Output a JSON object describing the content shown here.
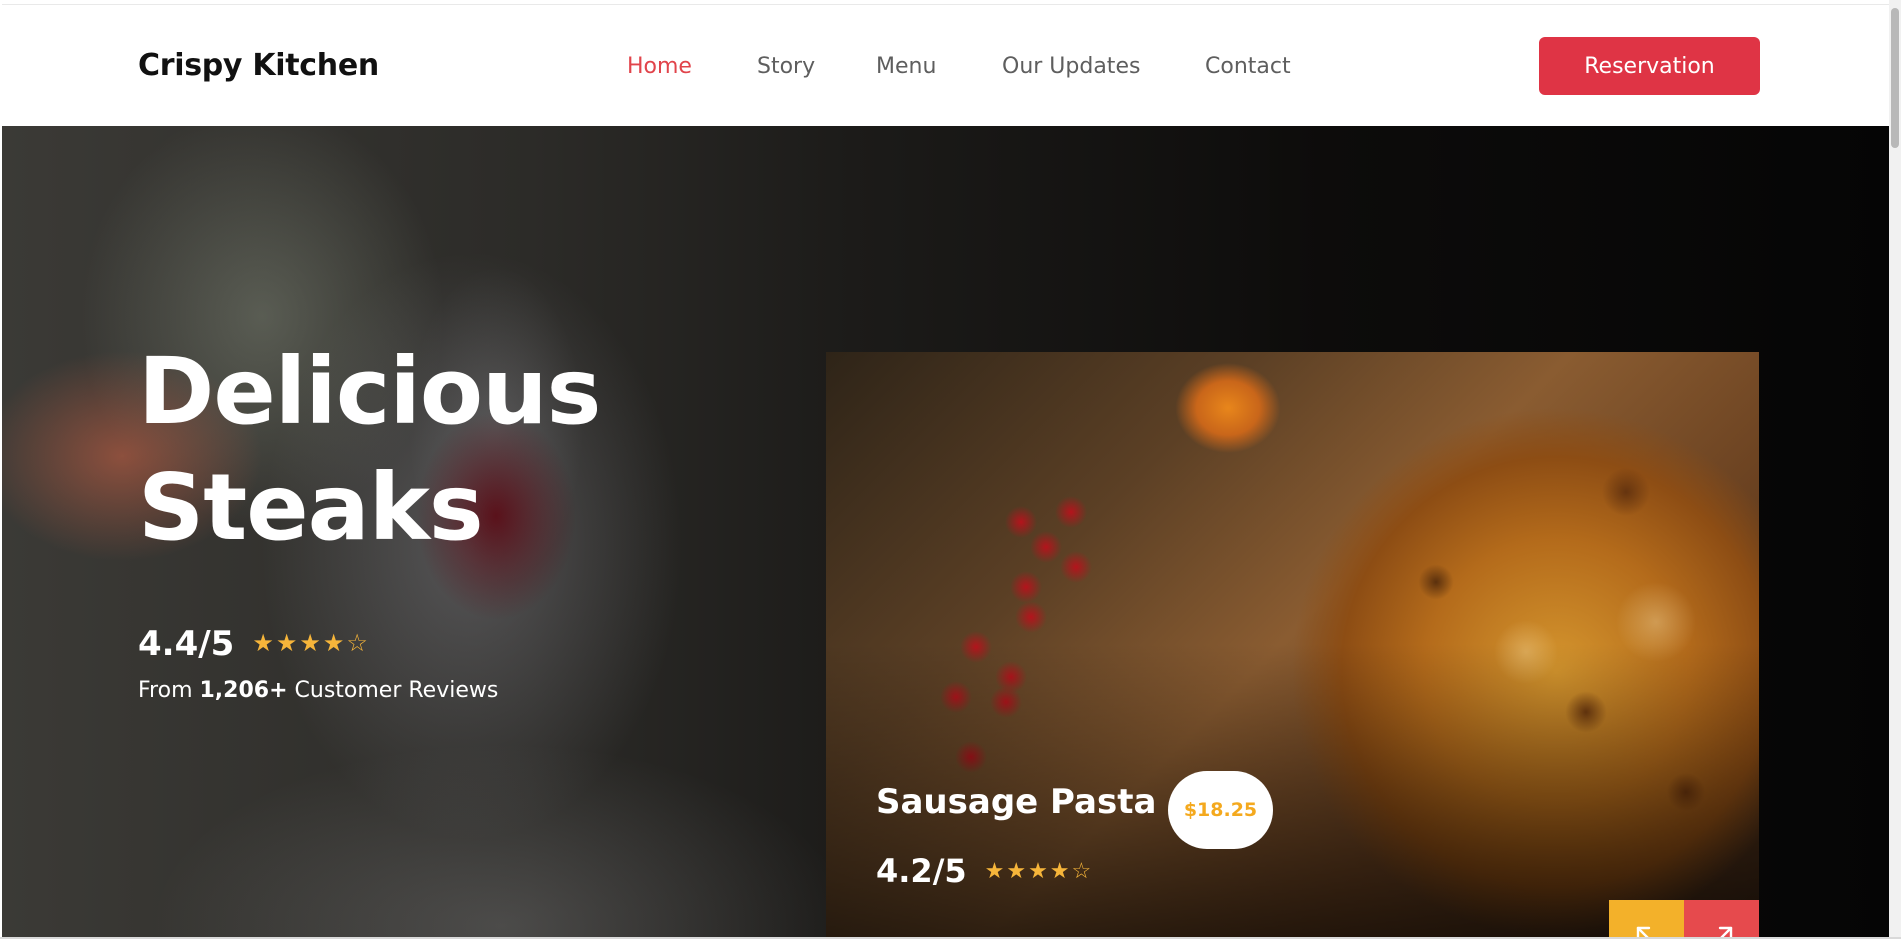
{
  "header": {
    "brand": "Crispy Kitchen",
    "nav": [
      {
        "label": "Home",
        "active": true
      },
      {
        "label": "Story"
      },
      {
        "label": "Menu"
      },
      {
        "label": "Our Updates"
      },
      {
        "label": "Contact"
      }
    ],
    "reservation_label": "Reservation"
  },
  "hero": {
    "title_line1": "Delicious",
    "title_line2": "Steaks",
    "rating": "4.4/5",
    "stars": "★★★★☆",
    "reviews_prefix": "From ",
    "reviews_count": "1,206+",
    "reviews_suffix": " Customer Reviews"
  },
  "featured": {
    "name": "Sausage Pasta",
    "price": "$18.25",
    "rating": "4.2/5",
    "stars": "★★★★☆",
    "prev_icon": "arrow-up-left-icon",
    "next_icon": "arrow-up-right-icon"
  },
  "colors": {
    "accent": "#df3445",
    "active_nav": "#e1444b",
    "star": "#f6b53a",
    "price": "#f4a91e",
    "prev_button": "#f3b12a",
    "next_button": "#e64a4d"
  }
}
